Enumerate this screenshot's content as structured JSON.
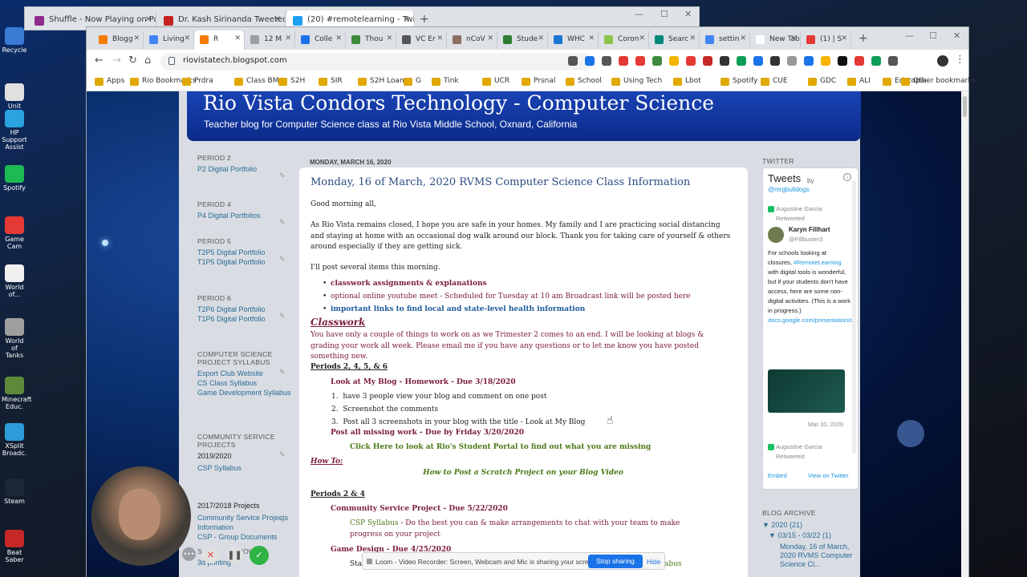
{
  "desktop": {
    "icons": [
      {
        "label": "Recycle"
      },
      {
        "label": "Unit 2018"
      },
      {
        "label": "HP Support Assist"
      },
      {
        "label": "Spotify"
      },
      {
        "label": "Game Cam"
      },
      {
        "label": "World of..."
      },
      {
        "label": "World of Tanks"
      },
      {
        "label": "Minecraft Educ."
      },
      {
        "label": "XSplit Broadc."
      },
      {
        "label": "Steam"
      },
      {
        "label": "Beat Saber"
      }
    ]
  },
  "back_window": {
    "tabs": [
      {
        "label": "Shuffle - Now Playing on Pa",
        "favcolor": "#8e2a8a"
      },
      {
        "label": "Dr. Kash Sirinanda Tweeted: Tim",
        "favcolor": "#c5221f"
      },
      {
        "label": "(20) #remotelearning - Twitter Se",
        "favcolor": "#1da1f2"
      }
    ]
  },
  "browser": {
    "tabs": [
      {
        "label": "Blogg",
        "favcolor": "#f57c00"
      },
      {
        "label": "Living",
        "favcolor": "#4285f4"
      },
      {
        "label": "R",
        "favcolor": "#f57c00"
      },
      {
        "label": "12 M",
        "favcolor": "#9aa0a6"
      },
      {
        "label": "Colle",
        "favcolor": "#1a73e8"
      },
      {
        "label": "Thou",
        "favcolor": "#3d8b3d"
      },
      {
        "label": "VC Er",
        "favcolor": "#555"
      },
      {
        "label": "nCoV",
        "favcolor": "#8d6e63"
      },
      {
        "label": "Stude",
        "favcolor": "#2e7d32"
      },
      {
        "label": "WHC",
        "favcolor": "#1976d2"
      },
      {
        "label": "Coron",
        "favcolor": "#8bc34a"
      },
      {
        "label": "Searc",
        "favcolor": "#00897b"
      },
      {
        "label": "settin",
        "favcolor": "#4285f4"
      },
      {
        "label": "New Tab",
        "favcolor": "#ffffff"
      },
      {
        "label": "(1) | S",
        "favcolor": "#e53935"
      }
    ],
    "url": "riovistatech.blogspot.com",
    "bookmarks": [
      "Apps",
      "Rio Bookmarks",
      "Prdra",
      "Class BM",
      "S2H",
      "SIR",
      "S2H Loaner",
      "G",
      "Tink",
      "UCR",
      "Prsnal",
      "School",
      "Using Tech",
      "Lbot",
      "Spotify",
      "CUE",
      "GDC",
      "ALI",
      "Edutopia",
      "Other bookmarks"
    ]
  },
  "blog": {
    "title": "Rio Vista Condors Technology - Computer Science",
    "description": "Teacher blog for Computer Science class at Rio Vista Middle School, Oxnard, California",
    "sidebar_left": [
      {
        "header": "PERIOD 2",
        "links": [
          "P2 Digital Portfolio"
        ]
      },
      {
        "header": "PERIOD 4",
        "links": [
          "P4 Digital Portfolios"
        ]
      },
      {
        "header": "PERIOD 5",
        "links": [
          "T2P5 Digital Portfolio",
          "T1P5 Digital Portfolio"
        ]
      },
      {
        "header": "PERIOD 6",
        "links": [
          "T2P6 Digital Portfolio",
          "T1P6 Digital Portfolio"
        ]
      },
      {
        "header": "COMPUTER SCIENCE PROJECT SYLLABUS",
        "links": [
          "Esport Club Website",
          "CS Class Syllabus",
          "Game Development Syllabus"
        ]
      },
      {
        "header": "COMMUNITY SERVICE PROJECTS",
        "plain": "2019/2020",
        "links": [
          "CSP Syllabus"
        ]
      },
      {
        "header": "",
        "plain": "2017/2018 Projects",
        "links": [
          "Community Service Projects Information",
          "CSP - Group Documents"
        ]
      }
    ],
    "sidebar_left_partial": {
      "line1": "S",
      "line2": "VOU",
      "line3": "3d printing"
    },
    "post": {
      "date_header": "MONDAY, MARCH 16, 2020",
      "title": "Monday, 16 of March, 2020 RVMS Computer Science Class Information",
      "greeting": "Good morning all,",
      "para1": "As Rio Vista remains closed, I hope you are safe in your homes.  My family and I are practicing social distancing and staying at home with an occasional dog walk around our block.  Thank you for taking care of yourself & others around especially if they are getting sick.",
      "para2": "I'll post several items this morning.",
      "items": [
        "classwork assignments & explanations",
        "optional online youtube meet - Scheduled for Tuesday at 10 am  Broadcast link will be posted here",
        "important links to find local and state-level health information"
      ],
      "classwork_heading": "Classwork",
      "classwork_text": "You have only a couple of things to work on as we Trimester 2 comes to an end.  I will be looking at blogs & grading your work all week.  Please email me if you have any questions or to let me know you have posted something new.",
      "periods_a": "Periods 2, 4, 5, & 6",
      "task1": "Look at My Blog - Homework - Due 3/18/2020",
      "task1_steps": [
        "have 3 people view your blog and comment on one post",
        "Screenshot the comments",
        "Post all 3 screenshots in your blog with the title - Look at My Blog"
      ],
      "task2": "Post all missing work - Due by Friday 3/20/2020",
      "task2_link": "Click Here to look at Rio's Student Portal to find out what you are missing",
      "howto_label": "How To:",
      "howto_link": "How to Post a Scratch Project on your Blog Video",
      "periods_b": "Periods 2 & 4",
      "task3": "Community Service Project - Due 5/22/2020",
      "task3_link": "CSP Syllabus",
      "task3_text": " - Do the best you can & make arrangements to chat with your team to make progress on your project",
      "task4": "Game Design - Due 4/25/2020",
      "task4_sub": "Star",
      "task4_tail": "abus"
    },
    "sidebar_right": {
      "twitter_header": "TWITTER",
      "tweets_title": "Tweets",
      "tweets_by": "by",
      "handle": "@mrgbulldogs",
      "retweet1": "Augustine Garcia Retweeted",
      "author": "Karyn Fillhart",
      "author_handle": "@Fillbuster3",
      "tweet_text": "For schools looking at closures, ",
      "tweet_hashtag": "#RemoteLearning",
      "tweet_text2": " with digital tools is wonderful, but if your students don't have access, here are some non-digital activities. (This is a work in progress.)",
      "tweet_link": "docs.google.com/presentation/d...",
      "tweet_date": "Mar 10, 2020",
      "retweet2": "Augustine Garcia Retweeted",
      "embed": "Embed",
      "view_on": "View on Twitter",
      "archive_header": "BLOG ARCHIVE",
      "archive_year": "2020 (21)",
      "archive_week": "03/15 - 03/22 (1)",
      "archive_post": "Monday, 16 of March, 2020 RVMS Computer Science Cl..."
    }
  },
  "loom": {
    "message": "Loom - Video Recorder: Screen, Webcam and Mic is sharing your screen.",
    "stop": "Stop sharing",
    "hide": "Hide"
  }
}
